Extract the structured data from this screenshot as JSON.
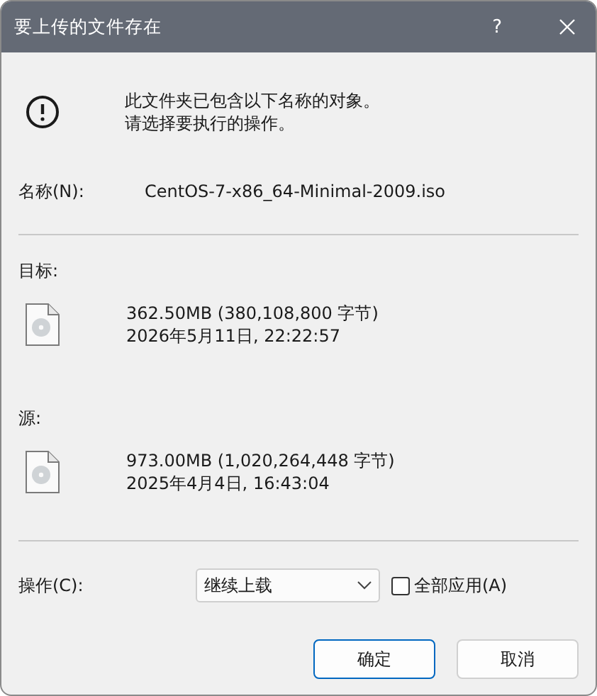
{
  "window": {
    "title": "要上传的文件存在",
    "help": "?"
  },
  "message": [
    "此文件夹已包含以下名称的对象。",
    "请选择要执行的操作。"
  ],
  "name": {
    "label": "名称(N):",
    "value": "CentOS-7-x86_64-Minimal-2009.iso"
  },
  "files": [
    {
      "label": "目标:",
      "size": "362.50MB (380,108,800 字节)",
      "date": "2026年5月11日, 22:22:57"
    },
    {
      "label": "源:",
      "size": "973.00MB (1,020,264,448 字节)",
      "date": "2025年4月4日, 16:43:04"
    }
  ],
  "action": {
    "label": "操作(C):",
    "value": "继续上载"
  },
  "apply_all": {
    "label": "全部应用(A)",
    "checked": false
  },
  "buttons": [
    {
      "label": "确定",
      "default": true
    },
    {
      "label": "取消",
      "default": false
    }
  ]
}
